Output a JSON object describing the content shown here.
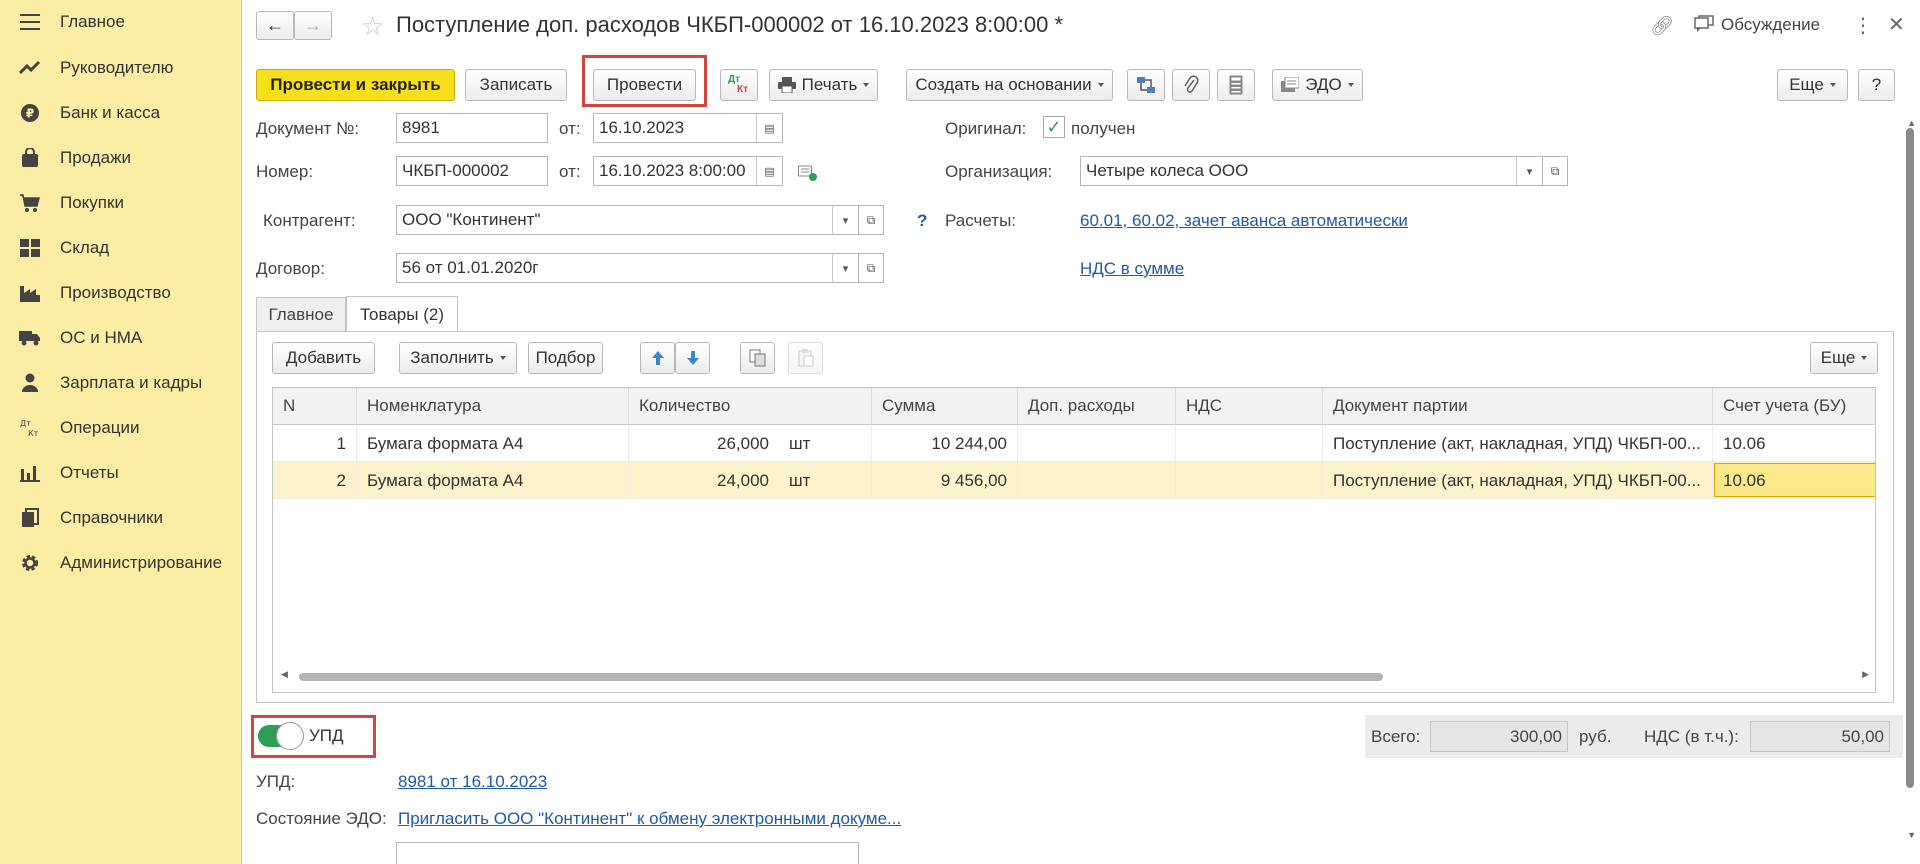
{
  "sidebar": {
    "items": [
      {
        "label": "Главное",
        "icon": "menu-icon"
      },
      {
        "label": "Руководителю",
        "icon": "trend-icon"
      },
      {
        "label": "Банк и касса",
        "icon": "ruble-icon"
      },
      {
        "label": "Продажи",
        "icon": "bag-icon"
      },
      {
        "label": "Покупки",
        "icon": "cart-icon"
      },
      {
        "label": "Склад",
        "icon": "warehouse-icon"
      },
      {
        "label": "Производство",
        "icon": "factory-icon"
      },
      {
        "label": "ОС и НМА",
        "icon": "truck-icon"
      },
      {
        "label": "Зарплата и кадры",
        "icon": "person-icon"
      },
      {
        "label": "Операции",
        "icon": "dt-kt-icon"
      },
      {
        "label": "Отчеты",
        "icon": "bar-chart-icon"
      },
      {
        "label": "Справочники",
        "icon": "books-icon"
      },
      {
        "label": "Администрирование",
        "icon": "gear-icon"
      }
    ]
  },
  "header": {
    "title": "Поступление доп. расходов ЧКБП-000002 от 16.10.2023 8:00:00 *",
    "discussion": "Обсуждение"
  },
  "toolbar": {
    "post_close": "Провести и закрыть",
    "save": "Записать",
    "post": "Провести",
    "dtkt_top": "Дт",
    "dtkt_bottom": "Кт",
    "print": "Печать",
    "create_based": "Создать на основании",
    "edo": "ЭДО",
    "more": "Еще",
    "help": "?"
  },
  "form": {
    "doc_no_label": "Документ №:",
    "doc_no": "8981",
    "from_label": "от:",
    "doc_date": "16.10.2023",
    "number_label": "Номер:",
    "number": "ЧКБП-000002",
    "number_date": "16.10.2023  8:00:00",
    "original_label": "Оригинал:",
    "original_value": "получен",
    "org_label": "Организация:",
    "org": "Четыре колеса ООО",
    "counterparty_label": "Контрагент:",
    "counterparty": "ООО \"Континент\"",
    "question": "?",
    "calc_label": "Расчеты:",
    "calc_link": "60.01, 60.02, зачет аванса автоматически",
    "contract_label": "Договор:",
    "contract": "56 от 01.01.2020г",
    "vat_link": "НДС в сумме"
  },
  "tabs": [
    {
      "label": "Главное"
    },
    {
      "label": "Товары (2)"
    }
  ],
  "table_toolbar": {
    "add": "Добавить",
    "fill": "Заполнить",
    "select": "Подбор",
    "more": "Еще"
  },
  "table": {
    "columns": [
      "N",
      "Номенклатура",
      "Количество",
      "Сумма",
      "Доп. расходы",
      "НДС",
      "Документ партии",
      "Счет учета (БУ)"
    ],
    "rows": [
      {
        "n": "1",
        "item": "Бумага формата А4",
        "qty": "26,000",
        "unit": "шт",
        "sum": "10 244,00",
        "extra": "",
        "vat": "",
        "batch": "Поступление (акт, накладная, УПД) ЧКБП-00...",
        "account": "10.06"
      },
      {
        "n": "2",
        "item": "Бумага формата А4",
        "qty": "24,000",
        "unit": "шт",
        "sum": "9 456,00",
        "extra": "",
        "vat": "",
        "batch": "Поступление (акт, накладная, УПД) ЧКБП-00...",
        "account": "10.06"
      }
    ]
  },
  "bottom": {
    "upd_toggle": "УПД",
    "upd_label": "УПД:",
    "upd_link": "8981 от 16.10.2023",
    "edo_state_label": "Состояние ЭДО:",
    "edo_state_link": "Пригласить ООО \"Континент\" к обмену электронными докуме...",
    "total_label": "Всего:",
    "total_value": "300,00",
    "currency": "руб.",
    "vat_label": "НДС (в т.ч.):",
    "vat_value": "50,00"
  },
  "colors": {
    "sidebar_bg": "#fbeda3",
    "primary_button": "#f7df1c",
    "highlight_frame": "#d0463f",
    "link": "#1f5aa6",
    "toggle_on": "#2e9d55",
    "selected_row": "#fcf3cc"
  }
}
